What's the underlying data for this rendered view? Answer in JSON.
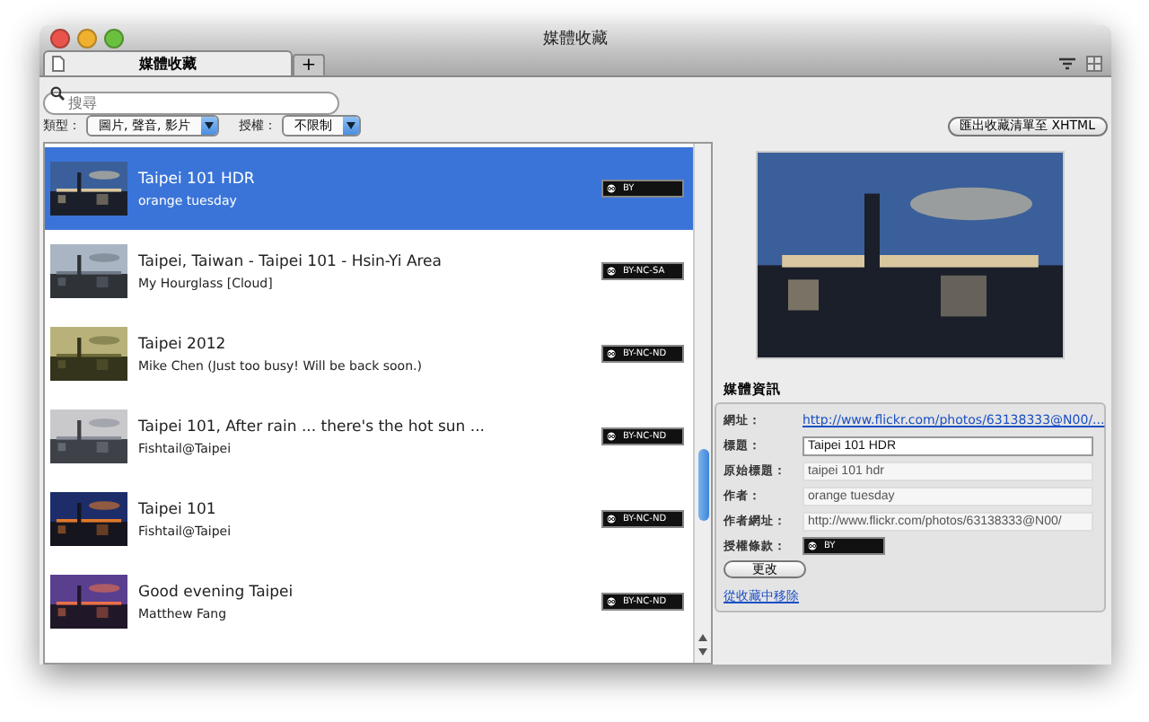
{
  "window": {
    "title": "媒體收藏"
  },
  "tabs": [
    {
      "label": "媒體收藏",
      "selected": true
    }
  ],
  "new_tab": "+",
  "search": {
    "placeholder": "搜尋"
  },
  "filters": [
    {
      "label": "類型：",
      "value": "圖片, 聲音, 影片"
    },
    {
      "label": "授權：",
      "value": "不限制"
    }
  ],
  "export_button": "匯出收藏清單至 XHTML",
  "items": [
    {
      "title": "Taipei 101 HDR",
      "author": "orange tuesday",
      "license": "BY",
      "selected": true
    },
    {
      "title": "Taipei, Taiwan - Taipei 101 - Hsin-Yi Area",
      "author": "My Hourglass [Cloud]",
      "license": "BY-NC-SA",
      "selected": false
    },
    {
      "title": "Taipei 2012",
      "author": "Mike Chen (Just too busy! Will be back soon.)",
      "license": "BY-NC-ND",
      "selected": false
    },
    {
      "title": "Taipei 101, After rain ... there's the hot sun ...",
      "author": "Fishtail@Taipei",
      "license": "BY-NC-ND",
      "selected": false
    },
    {
      "title": "Taipei 101",
      "author": "Fishtail@Taipei",
      "license": "BY-NC-ND",
      "selected": false
    },
    {
      "title": "Good evening Taipei",
      "author": "Matthew Fang",
      "license": "BY-NC-ND",
      "selected": false
    }
  ],
  "info": {
    "heading": "媒體資訊",
    "fields": [
      {
        "kind": "link",
        "label": "網址：",
        "value": "http://www.flickr.com/photos/63138333@N00/..."
      },
      {
        "kind": "input",
        "label": "標題：",
        "value": "Taipei 101 HDR",
        "disabled": false
      },
      {
        "kind": "input",
        "label": "原始標題：",
        "value": "taipei 101 hdr",
        "disabled": true
      },
      {
        "kind": "input",
        "label": "作者：",
        "value": "orange tuesday",
        "disabled": true
      },
      {
        "kind": "input",
        "label": "作者網址：",
        "value": "http://www.flickr.com/photos/63138333@N00/",
        "disabled": true
      },
      {
        "kind": "license",
        "label": "授權條款：",
        "value": "BY"
      }
    ],
    "button": "更改",
    "remove_link": "從收藏中移除"
  }
}
